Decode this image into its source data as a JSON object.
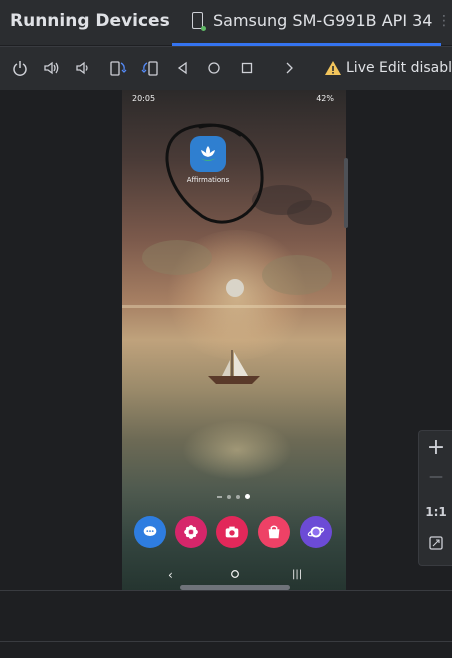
{
  "header": {
    "title": "Running Devices",
    "device_tab": "Samsung SM-G991B API 34",
    "status_color": "#5fb865",
    "accent": "#3574f0"
  },
  "toolbar": {
    "buttons": [
      "power-icon",
      "volume-up-icon",
      "volume-down-icon",
      "rotate-left-icon",
      "rotate-right-icon",
      "back-icon",
      "home-icon",
      "overview-icon",
      "more-icon"
    ],
    "live_edit_text": "Live Edit disable"
  },
  "phone": {
    "status_time": "20:05",
    "battery": "42%",
    "app_label": "Affirmations",
    "dock_apps": [
      "messages-icon",
      "flower-icon",
      "camera-icon",
      "store-icon",
      "browser-icon"
    ],
    "page_indicator": {
      "count": 4,
      "active": 3
    }
  },
  "zoom_panel": {
    "zoom_in": "+",
    "zoom_out": "—",
    "actual_size": "1:1"
  }
}
